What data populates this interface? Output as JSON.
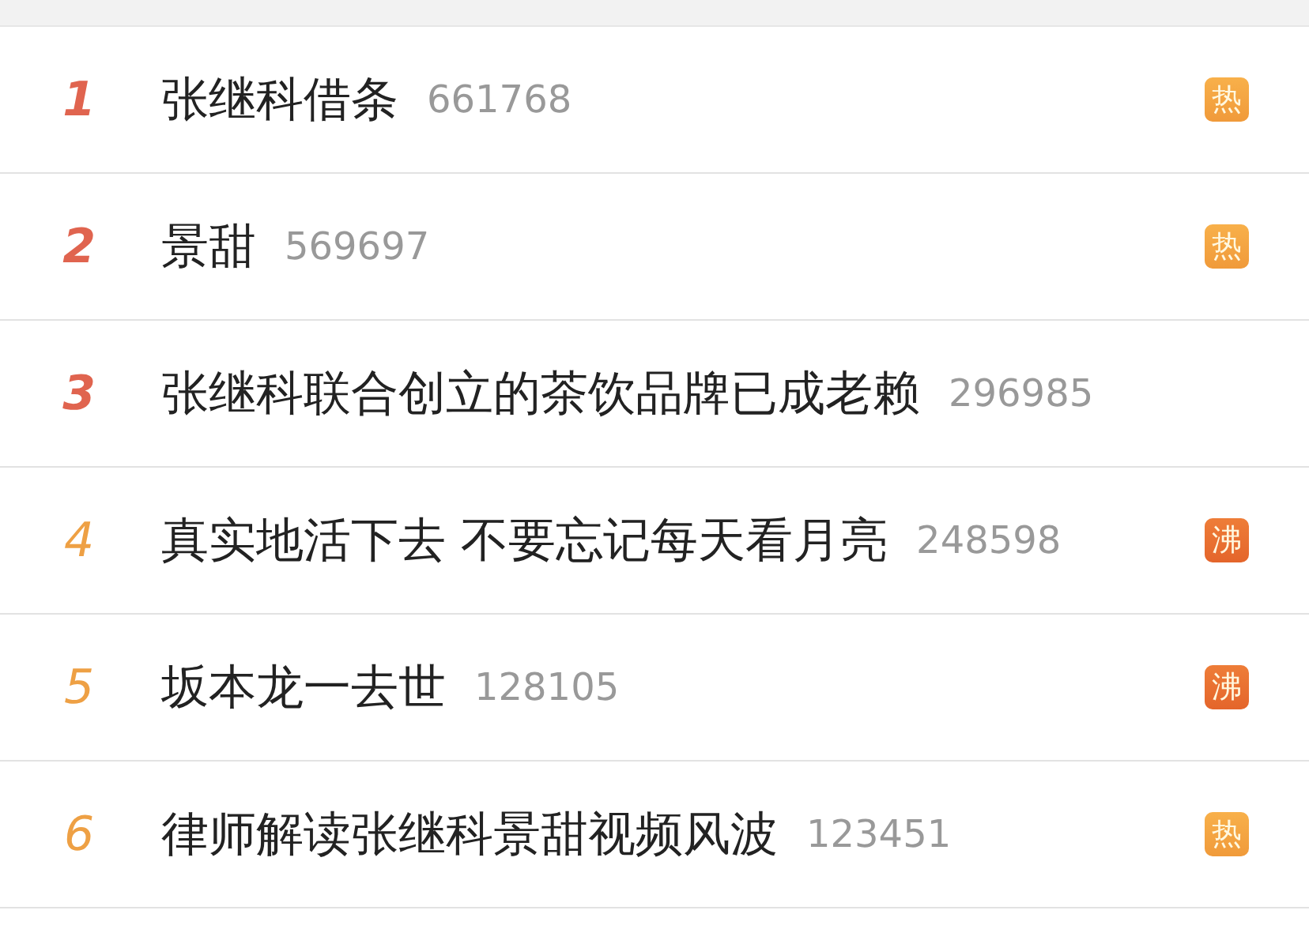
{
  "items": [
    {
      "rank": "1",
      "kind": "top",
      "title": "张继科借条",
      "count": "661768",
      "badge": {
        "text": "热",
        "kind": "hot"
      }
    },
    {
      "rank": "2",
      "kind": "top",
      "title": "景甜",
      "count": "569697",
      "badge": {
        "text": "热",
        "kind": "hot"
      }
    },
    {
      "rank": "3",
      "kind": "top",
      "title": "张继科联合创立的茶饮品牌已成老赖",
      "count": "296985"
    },
    {
      "rank": "4",
      "kind": "normal",
      "title": "真实地活下去 不要忘记每天看月亮",
      "count": "248598",
      "badge": {
        "text": "沸",
        "kind": "boil"
      }
    },
    {
      "rank": "5",
      "kind": "normal",
      "title": "坂本龙一去世",
      "count": "128105",
      "badge": {
        "text": "沸",
        "kind": "boil"
      }
    },
    {
      "rank": "6",
      "kind": "normal",
      "title": "律师解读张继科景甜视频风波",
      "count": "123451",
      "badge": {
        "text": "热",
        "kind": "hot"
      }
    }
  ]
}
